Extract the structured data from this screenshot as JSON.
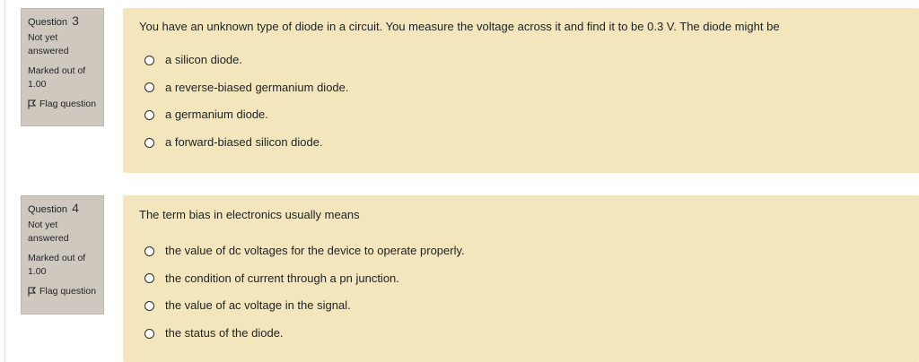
{
  "questions": [
    {
      "label": "Question",
      "number": "3",
      "state": "Not yet answered",
      "grade": "Marked out of 1.00",
      "flag": "Flag question",
      "text": "You have an unknown type of diode in a circuit. You measure the voltage across it and find it to be 0.3 V. The diode might be",
      "options": [
        "a silicon diode.",
        "a reverse-biased germanium diode.",
        "a germanium diode.",
        "a forward-biased silicon diode."
      ]
    },
    {
      "label": "Question",
      "number": "4",
      "state": "Not yet answered",
      "grade": "Marked out of 1.00",
      "flag": "Flag question",
      "text": "The term bias in electronics usually means",
      "options": [
        "the value of dc voltages for the device to operate properly.",
        "the condition of current through a pn junction.",
        "the value of ac voltage in the signal.",
        "the status of the diode."
      ]
    }
  ],
  "colors": {
    "info_bg": "#cfc8bf",
    "content_bg": "#f3e6bd"
  },
  "icons": {
    "flag": "flag-icon",
    "radio": "radio-unchecked-icon"
  }
}
